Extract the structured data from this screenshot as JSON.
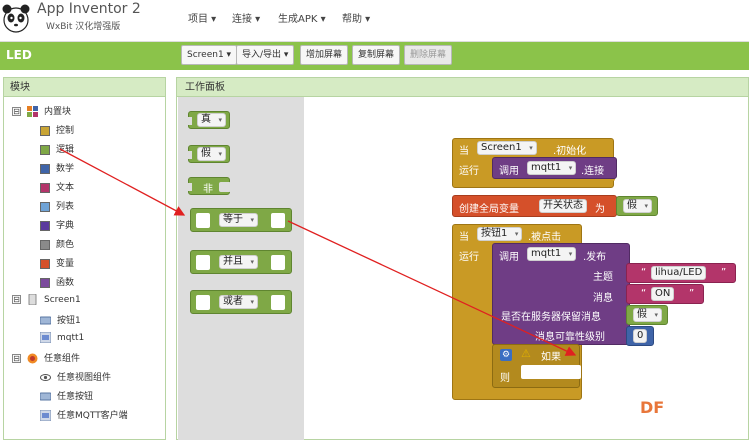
{
  "app": {
    "title": "App Inventor 2",
    "subtitle": "WxBit 汉化增强版"
  },
  "menu": [
    {
      "label": "项目 ▾"
    },
    {
      "label": "连接 ▾"
    },
    {
      "label": "生成APK ▾"
    },
    {
      "label": "帮助 ▾"
    }
  ],
  "toolbar": {
    "project_name": "LED",
    "screen_select": "Screen1 ▾",
    "import_export": "导入/导出 ▾",
    "add_screen": "增加屏幕",
    "copy_screen": "复制屏幕",
    "delete_screen": "删除屏幕"
  },
  "blocks_panel": {
    "header": "模块",
    "builtin": {
      "label": "内置块",
      "expand": "⊟"
    },
    "builtin_items": [
      {
        "label": "控制",
        "color": "#c9a535"
      },
      {
        "label": "逻辑",
        "color": "#7fa846"
      },
      {
        "label": "数学",
        "color": "#3f64a8"
      },
      {
        "label": "文本",
        "color": "#b3356a"
      },
      {
        "label": "列表",
        "color": "#6fa3d6"
      },
      {
        "label": "字典",
        "color": "#5b3a9e"
      },
      {
        "label": "颜色",
        "color": "#8a8a8a"
      },
      {
        "label": "变量",
        "color": "#d5502a"
      },
      {
        "label": "函数",
        "color": "#7b4a9c"
      }
    ],
    "screen": {
      "label": "Screen1",
      "expand": "⊟"
    },
    "screen_items": [
      {
        "label": "按钮1"
      },
      {
        "label": "mqtt1"
      }
    ],
    "any": {
      "label": "任意组件",
      "expand": "⊟"
    },
    "any_items": [
      {
        "label": "任意视图组件"
      },
      {
        "label": "任意按钮"
      },
      {
        "label": "任意MQTT客户端"
      }
    ]
  },
  "workspace": {
    "header": "工作面板",
    "flyout": {
      "true_label": "真",
      "false_label": "假",
      "not_label": "非",
      "equals_label": "等于",
      "and_label": "并且",
      "or_label": "或者"
    },
    "init_event": {
      "when": "当",
      "component": "Screen1",
      "event": ".初始化",
      "do": "运行",
      "call": "调用",
      "target": "mqtt1",
      "method": ".连接"
    },
    "global_var": {
      "label": "创建全局变量",
      "name": "开关状态",
      "to": "为",
      "value": "假"
    },
    "click_event": {
      "when": "当",
      "component": "按钮1",
      "event": ".被点击",
      "do": "运行",
      "call": "调用",
      "target": "mqtt1",
      "method": ".发布",
      "params": {
        "topic": "主题",
        "message": "消息",
        "retain": "是否在服务器保留消息",
        "qos": "消息可靠性级别"
      },
      "topic_value": "lihua/LED",
      "message_value": "ON",
      "retain_value": "假",
      "qos_value": "0",
      "if_label": "如果",
      "then_label": "则"
    }
  },
  "watermark": "DF"
}
